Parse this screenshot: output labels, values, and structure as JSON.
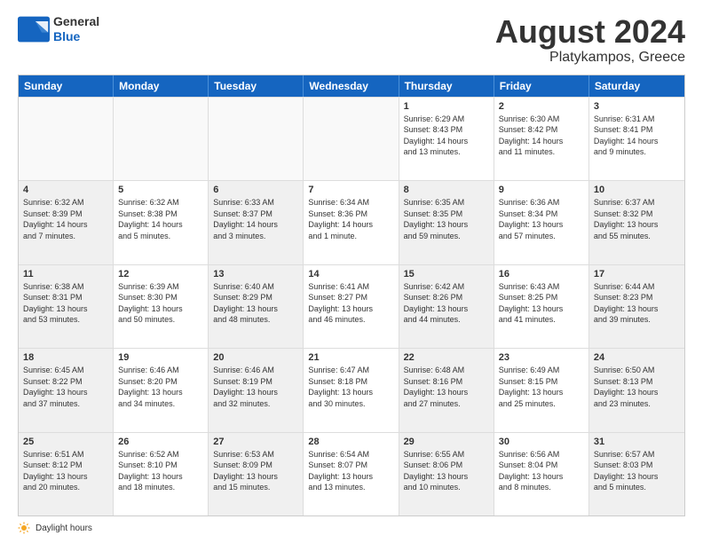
{
  "header": {
    "logo_general": "General",
    "logo_blue": "Blue",
    "title": "August 2024",
    "location": "Platykampos, Greece"
  },
  "days_of_week": [
    "Sunday",
    "Monday",
    "Tuesday",
    "Wednesday",
    "Thursday",
    "Friday",
    "Saturday"
  ],
  "weeks": [
    [
      {
        "day": "",
        "info": "",
        "empty": true
      },
      {
        "day": "",
        "info": "",
        "empty": true
      },
      {
        "day": "",
        "info": "",
        "empty": true
      },
      {
        "day": "",
        "info": "",
        "empty": true
      },
      {
        "day": "1",
        "info": "Sunrise: 6:29 AM\nSunset: 8:43 PM\nDaylight: 14 hours\nand 13 minutes."
      },
      {
        "day": "2",
        "info": "Sunrise: 6:30 AM\nSunset: 8:42 PM\nDaylight: 14 hours\nand 11 minutes."
      },
      {
        "day": "3",
        "info": "Sunrise: 6:31 AM\nSunset: 8:41 PM\nDaylight: 14 hours\nand 9 minutes."
      }
    ],
    [
      {
        "day": "4",
        "info": "Sunrise: 6:32 AM\nSunset: 8:39 PM\nDaylight: 14 hours\nand 7 minutes.",
        "shaded": true
      },
      {
        "day": "5",
        "info": "Sunrise: 6:32 AM\nSunset: 8:38 PM\nDaylight: 14 hours\nand 5 minutes."
      },
      {
        "day": "6",
        "info": "Sunrise: 6:33 AM\nSunset: 8:37 PM\nDaylight: 14 hours\nand 3 minutes.",
        "shaded": true
      },
      {
        "day": "7",
        "info": "Sunrise: 6:34 AM\nSunset: 8:36 PM\nDaylight: 14 hours\nand 1 minute."
      },
      {
        "day": "8",
        "info": "Sunrise: 6:35 AM\nSunset: 8:35 PM\nDaylight: 13 hours\nand 59 minutes.",
        "shaded": true
      },
      {
        "day": "9",
        "info": "Sunrise: 6:36 AM\nSunset: 8:34 PM\nDaylight: 13 hours\nand 57 minutes."
      },
      {
        "day": "10",
        "info": "Sunrise: 6:37 AM\nSunset: 8:32 PM\nDaylight: 13 hours\nand 55 minutes.",
        "shaded": true
      }
    ],
    [
      {
        "day": "11",
        "info": "Sunrise: 6:38 AM\nSunset: 8:31 PM\nDaylight: 13 hours\nand 53 minutes.",
        "shaded": true
      },
      {
        "day": "12",
        "info": "Sunrise: 6:39 AM\nSunset: 8:30 PM\nDaylight: 13 hours\nand 50 minutes."
      },
      {
        "day": "13",
        "info": "Sunrise: 6:40 AM\nSunset: 8:29 PM\nDaylight: 13 hours\nand 48 minutes.",
        "shaded": true
      },
      {
        "day": "14",
        "info": "Sunrise: 6:41 AM\nSunset: 8:27 PM\nDaylight: 13 hours\nand 46 minutes."
      },
      {
        "day": "15",
        "info": "Sunrise: 6:42 AM\nSunset: 8:26 PM\nDaylight: 13 hours\nand 44 minutes.",
        "shaded": true
      },
      {
        "day": "16",
        "info": "Sunrise: 6:43 AM\nSunset: 8:25 PM\nDaylight: 13 hours\nand 41 minutes."
      },
      {
        "day": "17",
        "info": "Sunrise: 6:44 AM\nSunset: 8:23 PM\nDaylight: 13 hours\nand 39 minutes.",
        "shaded": true
      }
    ],
    [
      {
        "day": "18",
        "info": "Sunrise: 6:45 AM\nSunset: 8:22 PM\nDaylight: 13 hours\nand 37 minutes.",
        "shaded": true
      },
      {
        "day": "19",
        "info": "Sunrise: 6:46 AM\nSunset: 8:20 PM\nDaylight: 13 hours\nand 34 minutes."
      },
      {
        "day": "20",
        "info": "Sunrise: 6:46 AM\nSunset: 8:19 PM\nDaylight: 13 hours\nand 32 minutes.",
        "shaded": true
      },
      {
        "day": "21",
        "info": "Sunrise: 6:47 AM\nSunset: 8:18 PM\nDaylight: 13 hours\nand 30 minutes."
      },
      {
        "day": "22",
        "info": "Sunrise: 6:48 AM\nSunset: 8:16 PM\nDaylight: 13 hours\nand 27 minutes.",
        "shaded": true
      },
      {
        "day": "23",
        "info": "Sunrise: 6:49 AM\nSunset: 8:15 PM\nDaylight: 13 hours\nand 25 minutes."
      },
      {
        "day": "24",
        "info": "Sunrise: 6:50 AM\nSunset: 8:13 PM\nDaylight: 13 hours\nand 23 minutes.",
        "shaded": true
      }
    ],
    [
      {
        "day": "25",
        "info": "Sunrise: 6:51 AM\nSunset: 8:12 PM\nDaylight: 13 hours\nand 20 minutes.",
        "shaded": true
      },
      {
        "day": "26",
        "info": "Sunrise: 6:52 AM\nSunset: 8:10 PM\nDaylight: 13 hours\nand 18 minutes."
      },
      {
        "day": "27",
        "info": "Sunrise: 6:53 AM\nSunset: 8:09 PM\nDaylight: 13 hours\nand 15 minutes.",
        "shaded": true
      },
      {
        "day": "28",
        "info": "Sunrise: 6:54 AM\nSunset: 8:07 PM\nDaylight: 13 hours\nand 13 minutes."
      },
      {
        "day": "29",
        "info": "Sunrise: 6:55 AM\nSunset: 8:06 PM\nDaylight: 13 hours\nand 10 minutes.",
        "shaded": true
      },
      {
        "day": "30",
        "info": "Sunrise: 6:56 AM\nSunset: 8:04 PM\nDaylight: 13 hours\nand 8 minutes."
      },
      {
        "day": "31",
        "info": "Sunrise: 6:57 AM\nSunset: 8:03 PM\nDaylight: 13 hours\nand 5 minutes.",
        "shaded": true
      }
    ]
  ],
  "footer": {
    "daylight_label": "Daylight hours"
  }
}
